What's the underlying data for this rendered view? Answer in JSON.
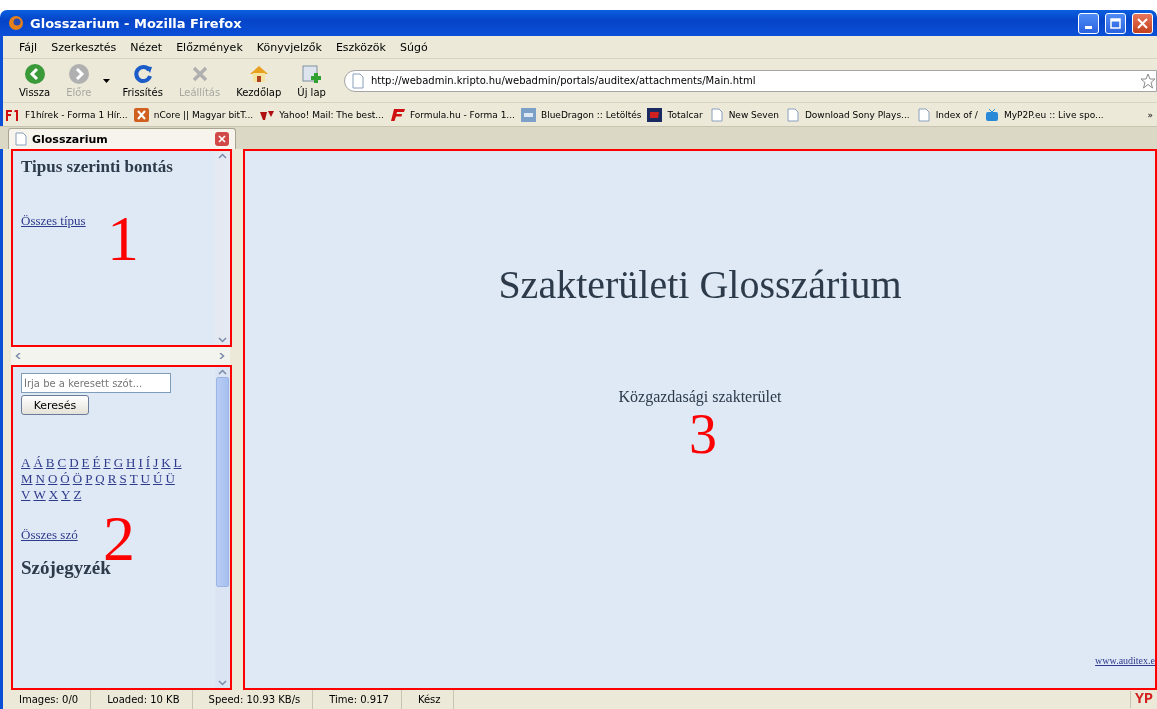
{
  "window": {
    "title": "Glosszarium - Mozilla Firefox"
  },
  "menu": [
    "Fájl",
    "Szerkesztés",
    "Nézet",
    "Előzmények",
    "Könyvjelzők",
    "Eszközök",
    "Súgó"
  ],
  "toolbar": [
    {
      "kind": "back",
      "label": "Vissza",
      "disabled": false
    },
    {
      "kind": "forward",
      "label": "Előre",
      "disabled": true
    },
    {
      "kind": "reload",
      "label": "Frissítés",
      "disabled": false
    },
    {
      "kind": "stop",
      "label": "Leállítás",
      "disabled": true
    },
    {
      "kind": "home",
      "label": "Kezdőlap",
      "disabled": false
    },
    {
      "kind": "newtab",
      "label": "Új lap",
      "disabled": false
    }
  ],
  "address": {
    "value": "http://webadmin.kripto.hu/webadmin/portals/auditex/attachments/Main.html"
  },
  "bookmarks": [
    {
      "kind": "f1",
      "label": "F1hírek - Forma 1 Hír..."
    },
    {
      "kind": "ncore",
      "label": "nCore || Magyar bitT..."
    },
    {
      "kind": "yahoo",
      "label": "Yahoo! Mail: The best..."
    },
    {
      "kind": "formula",
      "label": "Formula.hu - Forma 1..."
    },
    {
      "kind": "blue",
      "label": "BlueDragon :: Letöltés"
    },
    {
      "kind": "totalcar",
      "label": "Totalcar"
    },
    {
      "kind": "page",
      "label": "New Seven"
    },
    {
      "kind": "page",
      "label": "Download Sony Plays..."
    },
    {
      "kind": "page",
      "label": "Index of /"
    },
    {
      "kind": "tv",
      "label": "MyP2P.eu :: Live spo..."
    }
  ],
  "bookmarks_overflow": "»",
  "tabs": [
    {
      "label": "Glosszarium",
      "selected": true
    }
  ],
  "frame_types": {
    "heading": "Tipus szerinti bontás",
    "link": "Összes típus",
    "annotation": "1"
  },
  "frame_words": {
    "search": {
      "placeholder": "Írja be a keresett szót...",
      "button": "Keresés"
    },
    "letter_rows": [
      [
        "A",
        "Á",
        "B",
        "C",
        "D",
        "E",
        "É",
        "F",
        "G",
        "H",
        "I",
        "Í",
        "J",
        "K",
        "L"
      ],
      [
        "M",
        "N",
        "O",
        "Ó",
        "Ö",
        "P",
        "Q",
        "R",
        "S",
        "T",
        "U",
        "Ú",
        "Ü"
      ],
      [
        "V",
        "W",
        "X",
        "Y",
        "Z"
      ]
    ],
    "link": "Összes szó",
    "heading": "Szójegyzék",
    "annotation": "2"
  },
  "frame_main": {
    "title": "Szakterületi Glosszárium",
    "subtitle": "Közgazdasági szakterület",
    "footer_link": "www.auditex.e",
    "annotation": "3"
  },
  "status_bar": {
    "items": [
      "Images: 0/0",
      "Loaded: 10 KB",
      "Speed: 10.93 KB/s",
      "Time: 0.917",
      "Kész"
    ],
    "badge": "YP"
  }
}
